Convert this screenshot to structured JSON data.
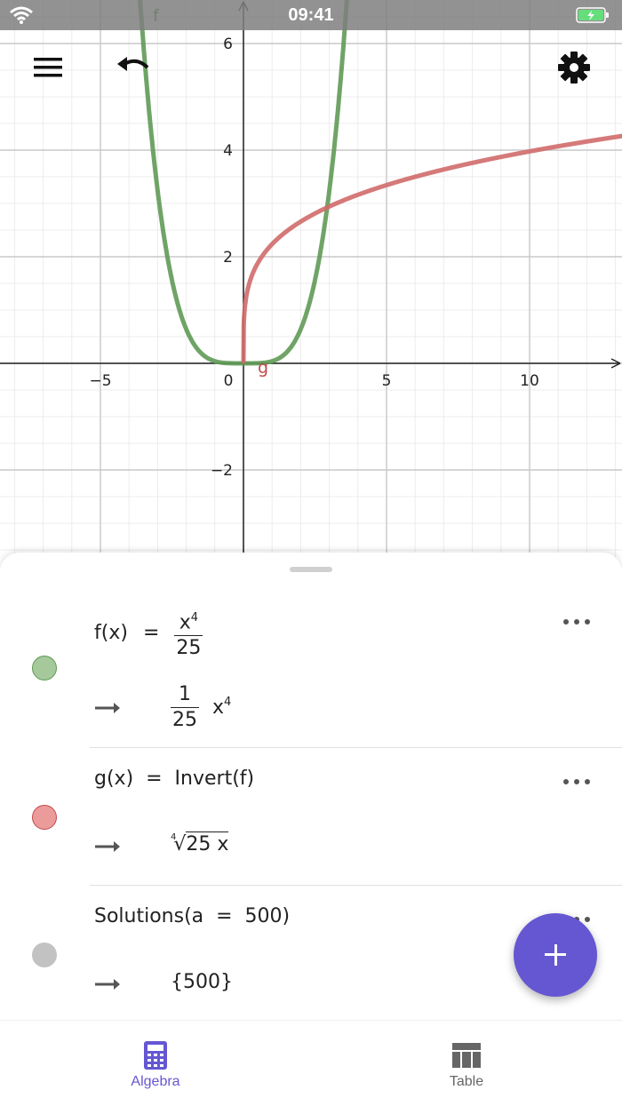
{
  "status_bar": {
    "time": "09:41"
  },
  "graph": {
    "x_ticks": [
      "−5",
      "0",
      "5",
      "10"
    ],
    "y_ticks": [
      "6",
      "4",
      "2",
      "−2"
    ],
    "curve_labels": {
      "f": "f",
      "g": "g"
    },
    "colors": {
      "f": "#5f9a55",
      "g": "#d06a6a",
      "axis": "#222222",
      "grid_major": "#c8c8c8",
      "grid_minor": "#ececec"
    }
  },
  "toolbar": {
    "menu_icon": "menu-icon",
    "undo_icon": "undo-icon",
    "settings_icon": "gear-icon"
  },
  "algebra": {
    "rows": [
      {
        "color": "#a5c99b",
        "border": "#5f9a55",
        "def_name": "f(x)",
        "eq": "=",
        "def_num": "x",
        "def_num_exp": "4",
        "def_den": "25",
        "out_num": "1",
        "out_den": "25",
        "out_var": "x",
        "out_exp": "4"
      },
      {
        "color": "#ec9b9b",
        "border": "#c24a4a",
        "def_text": "g(x)  =  Invert(f)",
        "out_root_index": "4",
        "out_radicand": "25 x"
      },
      {
        "color": "#c2c2c2",
        "border": "#c2c2c2",
        "def_text": "Solutions(a  =  500)",
        "out_text": "{500}"
      }
    ]
  },
  "bottom_nav": {
    "algebra_label": "Algebra",
    "table_label": "Table",
    "active_color": "#6557d2",
    "inactive_color": "#666666"
  }
}
